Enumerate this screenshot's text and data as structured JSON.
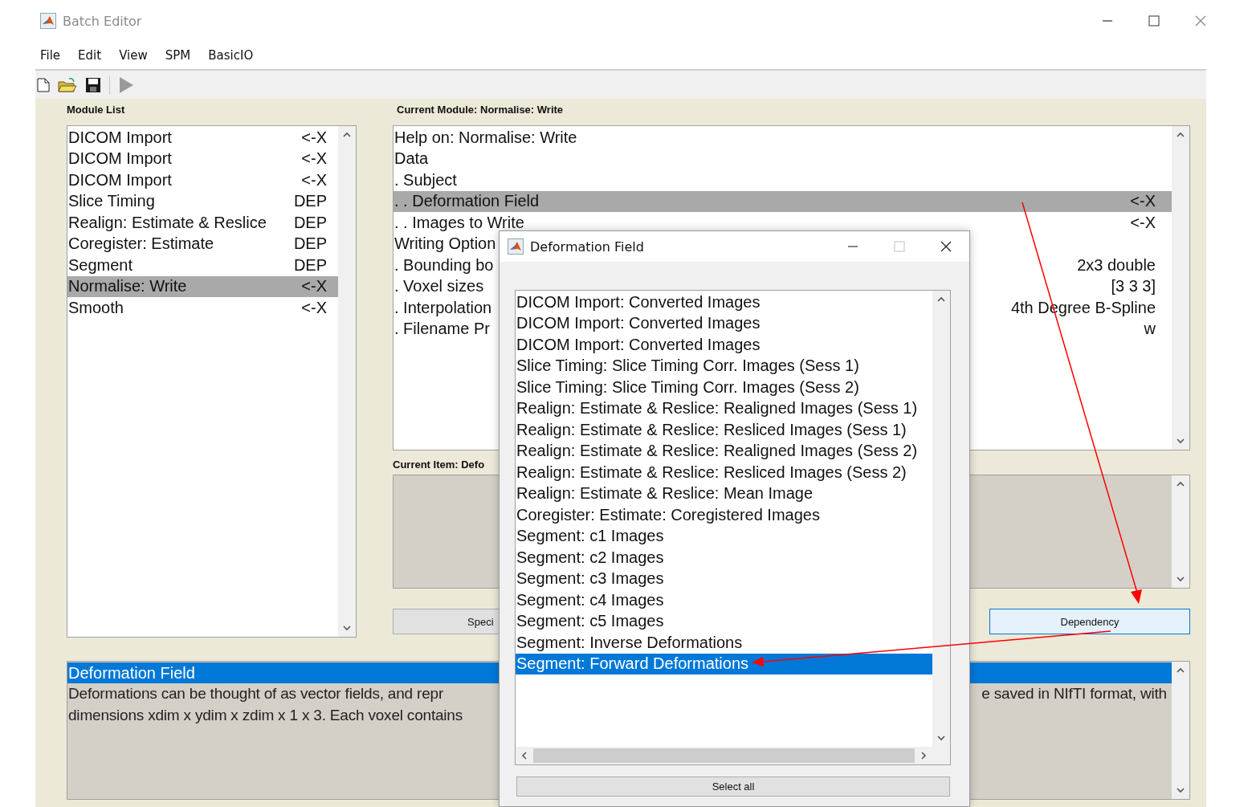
{
  "window": {
    "title": "Batch Editor"
  },
  "menu": [
    "File",
    "Edit",
    "View",
    "SPM",
    "BasicIO"
  ],
  "module_list": {
    "label": "Module List",
    "items": [
      {
        "name": "DICOM Import",
        "status": "<-X",
        "selected": false
      },
      {
        "name": "DICOM Import",
        "status": "<-X",
        "selected": false
      },
      {
        "name": "DICOM Import",
        "status": "<-X",
        "selected": false
      },
      {
        "name": "Slice Timing",
        "status": "DEP",
        "selected": false
      },
      {
        "name": "Realign: Estimate & Reslice",
        "status": "DEP",
        "selected": false
      },
      {
        "name": "Coregister: Estimate",
        "status": "DEP",
        "selected": false
      },
      {
        "name": "Segment",
        "status": "DEP",
        "selected": false
      },
      {
        "name": "Normalise: Write",
        "status": "<-X",
        "selected": true
      },
      {
        "name": "Smooth",
        "status": "<-X",
        "selected": false
      }
    ]
  },
  "current_module": {
    "label": "Current Module: Normalise: Write",
    "rows": [
      {
        "label": "Help on: Normalise: Write",
        "selected": false
      },
      {
        "label": "Data",
        "selected": false
      },
      {
        "label": ". Subject",
        "selected": false
      },
      {
        "label": ". . Deformation Field",
        "value": "<-X",
        "selected": true
      },
      {
        "label": ". . Images to Write",
        "value": "<-X",
        "selected": false
      },
      {
        "label": "Writing Option",
        "selected": false
      },
      {
        "label": ". Bounding bo",
        "value": "2x3 double",
        "selected": false
      },
      {
        "label": ". Voxel sizes",
        "value": "[3 3 3]",
        "selected": false
      },
      {
        "label": ". Interpolation",
        "value": "4th Degree B-Spline",
        "selected": false
      },
      {
        "label": ". Filename Pr",
        "value": "w",
        "selected": false
      }
    ]
  },
  "current_item": {
    "label": "Current Item: Defo"
  },
  "buttons": {
    "specify": "Speci",
    "dependency": "Dependency"
  },
  "help": {
    "title": "Deformation Field",
    "lines": [
      {
        "left": "Deformations  can  be  thought  of as vector fields, and repr",
        "right": "e saved in NIfTI format, with"
      },
      {
        "left": "dimensions xdim x ydim x zdim x 1 x 3. Each voxel contains"
      }
    ]
  },
  "dialog": {
    "title": "Deformation Field",
    "items": [
      {
        "label": "DICOM Import: Converted Images",
        "selected": false
      },
      {
        "label": "DICOM Import: Converted Images",
        "selected": false
      },
      {
        "label": "DICOM Import: Converted Images",
        "selected": false
      },
      {
        "label": "Slice Timing: Slice Timing Corr. Images (Sess 1)",
        "selected": false
      },
      {
        "label": "Slice Timing: Slice Timing Corr. Images (Sess 2)",
        "selected": false
      },
      {
        "label": "Realign: Estimate & Reslice: Realigned Images (Sess 1)",
        "selected": false
      },
      {
        "label": "Realign: Estimate & Reslice: Resliced Images (Sess 1)",
        "selected": false
      },
      {
        "label": "Realign: Estimate & Reslice: Realigned Images (Sess 2)",
        "selected": false
      },
      {
        "label": "Realign: Estimate & Reslice: Resliced Images (Sess 2)",
        "selected": false
      },
      {
        "label": "Realign: Estimate & Reslice: Mean Image",
        "selected": false
      },
      {
        "label": "Coregister: Estimate: Coregistered Images",
        "selected": false
      },
      {
        "label": "Segment: c1 Images",
        "selected": false
      },
      {
        "label": "Segment: c2 Images",
        "selected": false
      },
      {
        "label": "Segment: c3 Images",
        "selected": false
      },
      {
        "label": "Segment: c4 Images",
        "selected": false
      },
      {
        "label": "Segment: c5 Images",
        "selected": false
      },
      {
        "label": "Segment: Inverse Deformations",
        "selected": false
      },
      {
        "label": "Segment: Forward Deformations",
        "selected": true
      }
    ],
    "button": "Select all"
  }
}
